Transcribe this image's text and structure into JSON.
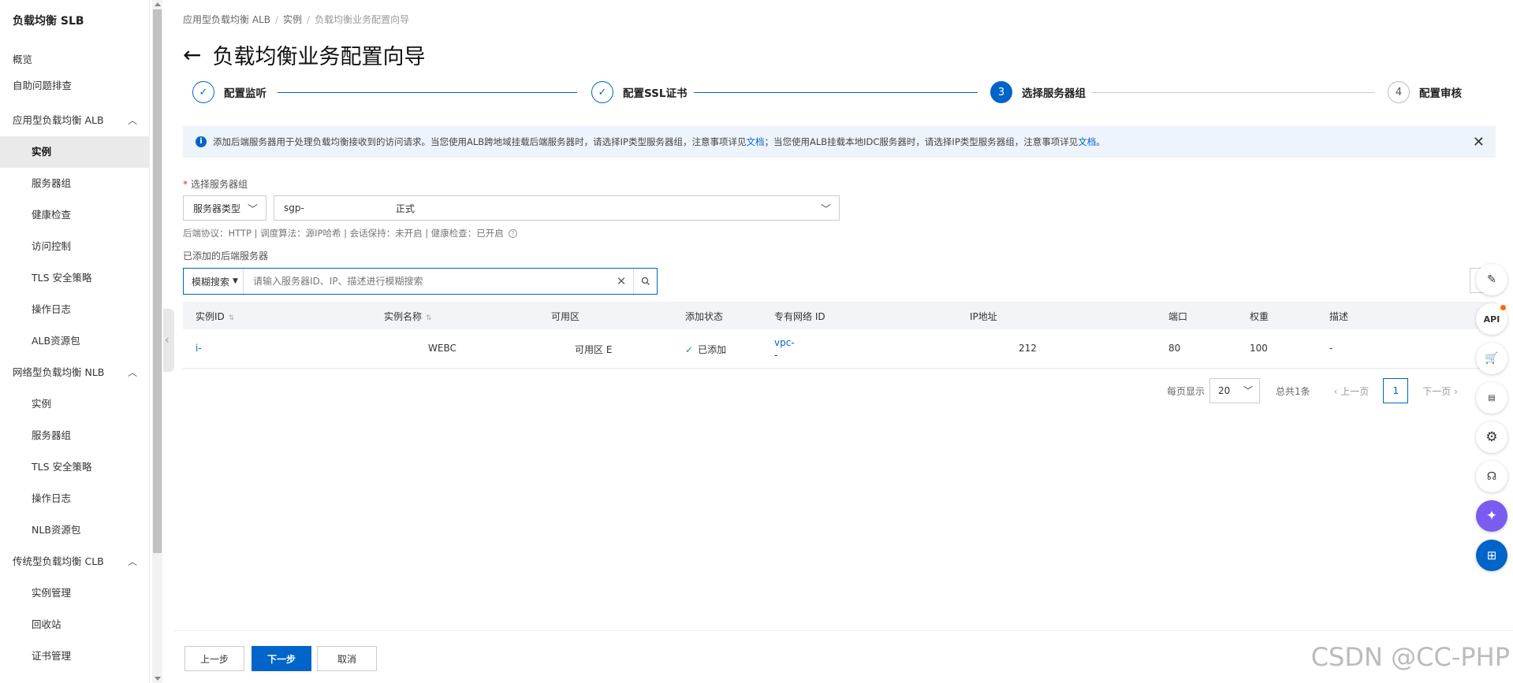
{
  "sidebar": {
    "title": "负载均衡 SLB",
    "items": [
      {
        "label": "概览",
        "level": 1
      },
      {
        "label": "自助问题排查",
        "level": 1
      },
      {
        "label": "应用型负载均衡 ALB",
        "level": 1,
        "expanded": true
      },
      {
        "label": "实例",
        "level": 2,
        "active": true
      },
      {
        "label": "服务器组",
        "level": 2
      },
      {
        "label": "健康检查",
        "level": 2
      },
      {
        "label": "访问控制",
        "level": 2
      },
      {
        "label": "TLS 安全策略",
        "level": 2
      },
      {
        "label": "操作日志",
        "level": 2
      },
      {
        "label": "ALB资源包",
        "level": 2
      },
      {
        "label": "网络型负载均衡 NLB",
        "level": 1,
        "expanded": true
      },
      {
        "label": "实例",
        "level": 2
      },
      {
        "label": "服务器组",
        "level": 2
      },
      {
        "label": "TLS 安全策略",
        "level": 2
      },
      {
        "label": "操作日志",
        "level": 2
      },
      {
        "label": "NLB资源包",
        "level": 2
      },
      {
        "label": "传统型负载均衡 CLB",
        "level": 1,
        "expanded": true
      },
      {
        "label": "实例管理",
        "level": 2
      },
      {
        "label": "回收站",
        "level": 2
      },
      {
        "label": "证书管理",
        "level": 2
      }
    ]
  },
  "breadcrumb": [
    "应用型负载均衡 ALB",
    "实例",
    "负载均衡业务配置向导"
  ],
  "page_title": "负载均衡业务配置向导",
  "steps": [
    {
      "label": "配置监听",
      "status": "done"
    },
    {
      "label": "配置SSL证书",
      "status": "done"
    },
    {
      "number": "3",
      "label": "选择服务器组",
      "status": "current"
    },
    {
      "number": "4",
      "label": "配置审核",
      "status": "todo"
    }
  ],
  "alert": {
    "text1": "添加后端服务器用于处理负载均衡接收到的访问请求。当您使用ALB跨地域挂载后端服务器时，请选择IP类型服务器组，注意事项详见",
    "link1": "文档",
    "text2": "；当您使用ALB挂载本地IDC服务器时，请选择IP类型服务器组，注意事项详见",
    "link2": "文档",
    "text3": "。"
  },
  "form": {
    "group_label": "选择服务器组",
    "type_select": "服务器类型",
    "group_select_id": "sgp-",
    "group_select_name": "正式",
    "server_info": "后端协议：HTTP | 调度算法：源IP哈希 | 会话保持：未开启 | 健康检查：已开启",
    "added_label": "已添加的后端服务器"
  },
  "search": {
    "filter": "模糊搜索",
    "placeholder": "请输入服务器ID、IP、描述进行模糊搜索"
  },
  "table": {
    "columns": [
      "实例ID",
      "实例名称",
      "可用区",
      "添加状态",
      "专有网络 ID",
      "IP地址",
      "端口",
      "权重",
      "描述"
    ],
    "rows": [
      {
        "id": "i-",
        "name": "WEBC",
        "zone": "可用区 E",
        "status": "已添加",
        "vpc": "vpc-",
        "vpc_sub": "-",
        "ip": "212",
        "port": "80",
        "weight": "100",
        "desc": "-"
      }
    ]
  },
  "pagination": {
    "per_page_label": "每页显示",
    "per_page": "20",
    "total": "总共1条",
    "prev": "上一页",
    "page": "1",
    "next": "下一页"
  },
  "footer": {
    "prev_button": "上一步",
    "next_button": "下一步",
    "cancel_button": "取消"
  },
  "watermark": "CSDN @CC-PHP",
  "colors": {
    "primary": "#0064c8",
    "success": "#1e9e4a",
    "alert_bg": "#eef4fb"
  }
}
